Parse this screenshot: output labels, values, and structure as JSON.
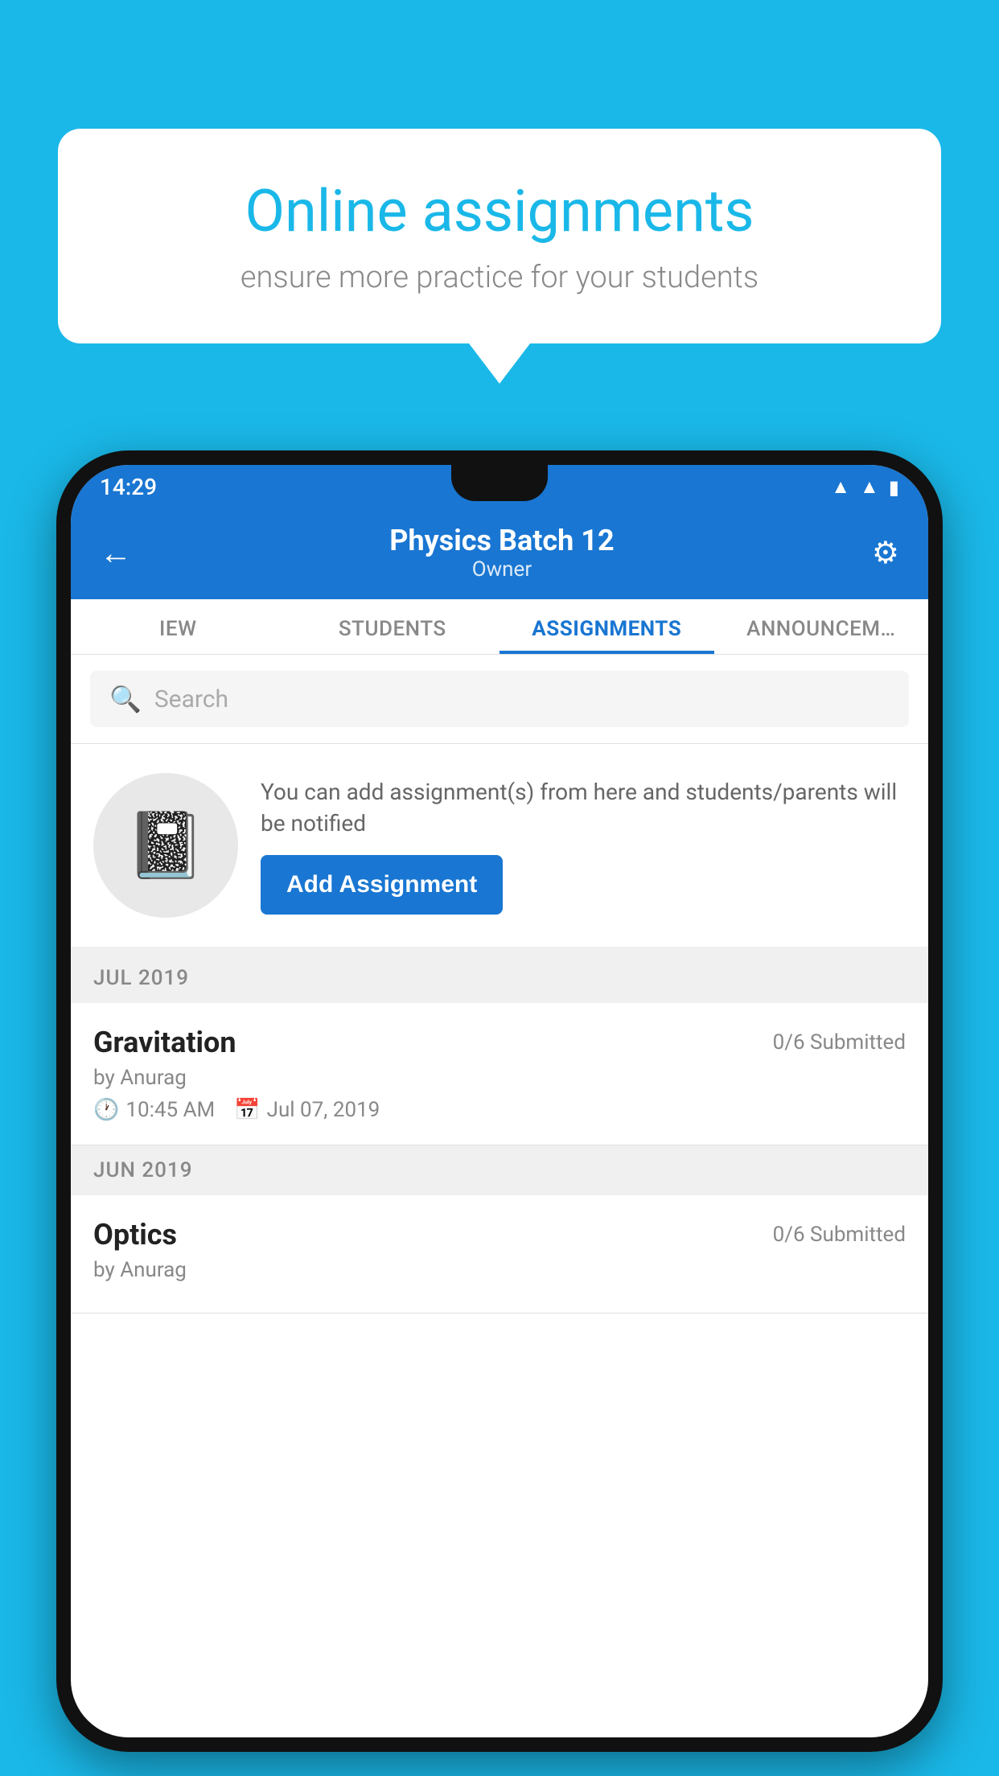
{
  "background_color": "#1ab8e8",
  "speech_bubble": {
    "title": "Online assignments",
    "subtitle": "ensure more practice for your students"
  },
  "phone": {
    "status_bar": {
      "time": "14:29"
    },
    "header": {
      "title": "Physics Batch 12",
      "subtitle": "Owner",
      "back_label": "←",
      "settings_label": "⚙"
    },
    "tabs": [
      {
        "label": "IEW",
        "active": false
      },
      {
        "label": "STUDENTS",
        "active": false
      },
      {
        "label": "ASSIGNMENTS",
        "active": true
      },
      {
        "label": "ANNOUNCEM…",
        "active": false
      }
    ],
    "search": {
      "placeholder": "Search"
    },
    "promo": {
      "description": "You can add assignment(s) from here and students/parents will be notified",
      "button_label": "Add Assignment"
    },
    "sections": [
      {
        "header": "JUL 2019",
        "assignments": [
          {
            "name": "Gravitation",
            "status": "0/6 Submitted",
            "by": "by Anurag",
            "time": "10:45 AM",
            "date": "Jul 07, 2019"
          }
        ]
      },
      {
        "header": "JUN 2019",
        "assignments": [
          {
            "name": "Optics",
            "status": "0/6 Submitted",
            "by": "by Anurag",
            "time": "",
            "date": ""
          }
        ]
      }
    ]
  }
}
